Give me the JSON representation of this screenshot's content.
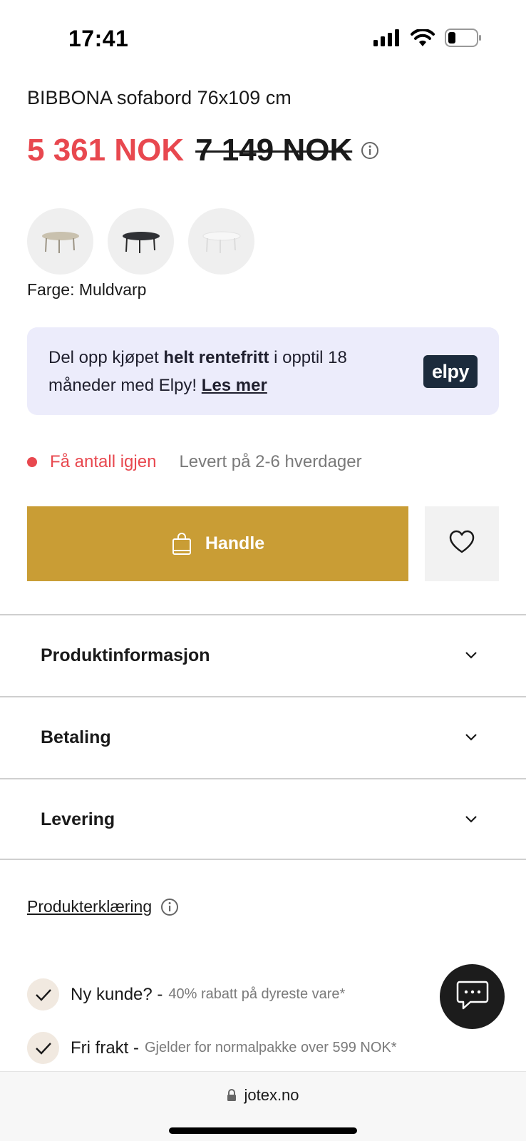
{
  "status_bar": {
    "time": "17:41"
  },
  "product": {
    "title": "BIBBONA sofabord 76x109 cm",
    "price_current": "5 361 NOK",
    "price_old": "7 149 NOK",
    "color_label": "Farge: Muldvarp"
  },
  "elpy": {
    "text_start": "Del opp kjøpet ",
    "text_bold": "helt rentefritt",
    "text_end": " i opptil 18 måneder med Elpy! ",
    "link": "Les mer",
    "logo": "elpy"
  },
  "stock": {
    "status": "Få antall igjen",
    "delivery": "Levert på 2-6 hverdager"
  },
  "actions": {
    "buy_label": "Handle"
  },
  "accordions": [
    {
      "label": "Produktinformasjon"
    },
    {
      "label": "Betaling"
    },
    {
      "label": "Levering"
    }
  ],
  "declaration": {
    "label": "Produkterklæring"
  },
  "perks": [
    {
      "title": "Ny kunde? -",
      "desc": "40% rabatt på dyreste vare*"
    },
    {
      "title": "Fri frakt -",
      "desc": "Gjelder for normalpakke over 599 NOK*"
    }
  ],
  "browser": {
    "url": "jotex.no"
  },
  "colors": {
    "sale_red": "#e8484f",
    "buy_gold": "#c99d35",
    "elpy_bg": "#ececfb",
    "elpy_logo": "#1c2b3c"
  }
}
